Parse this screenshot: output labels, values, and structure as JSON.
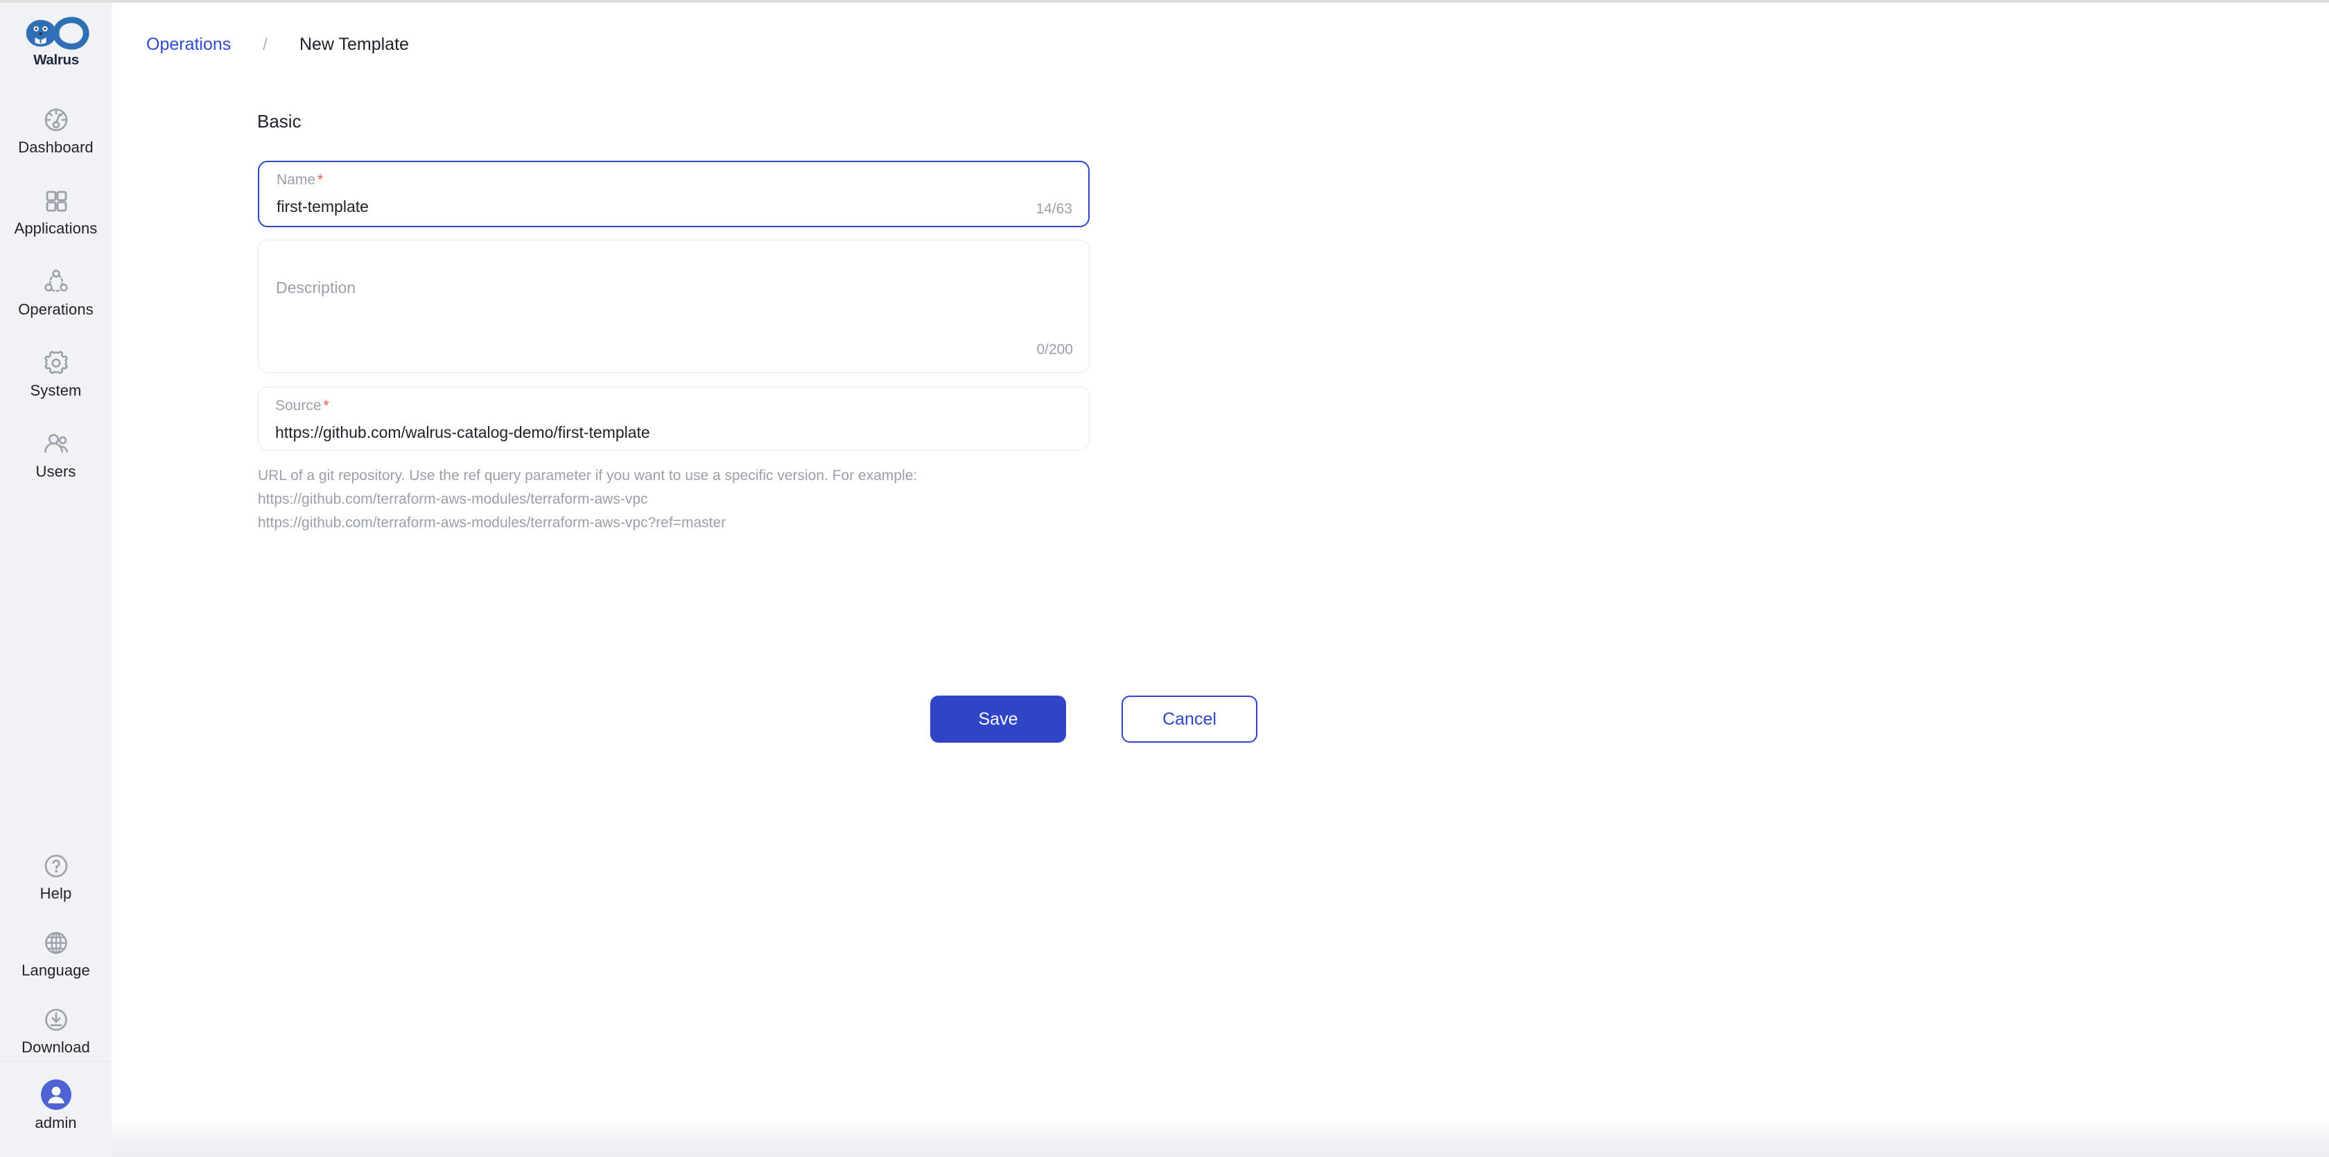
{
  "app": {
    "brand_name": "Walrus",
    "accent_color": "#2f45c5",
    "link_color": "#2f4ad0",
    "sidebar_bg": "#f1f2f4",
    "required_color": "#e8544a"
  },
  "sidebar": {
    "logo_icon": "walrus-infinity-logo",
    "items": [
      {
        "label": "Dashboard",
        "icon": "dashboard-gauge-icon"
      },
      {
        "label": "Applications",
        "icon": "grid-squares-icon"
      },
      {
        "label": "Operations",
        "icon": "nodes-network-icon"
      },
      {
        "label": "System",
        "icon": "gear-icon"
      },
      {
        "label": "Users",
        "icon": "users-icon"
      }
    ],
    "bottom_items": [
      {
        "label": "Help",
        "icon": "question-circle-icon"
      },
      {
        "label": "Language",
        "icon": "globe-icon"
      },
      {
        "label": "Download",
        "icon": "download-circle-icon"
      }
    ],
    "user": {
      "label": "admin",
      "icon": "user-avatar-icon"
    }
  },
  "breadcrumb": {
    "parent": "Operations",
    "separator": "/",
    "current": "New Template"
  },
  "main": {
    "section_title": "Basic",
    "fields": {
      "name": {
        "label": "Name",
        "required_marker": "*",
        "value": "first-template",
        "counter": "14/63",
        "focused": true
      },
      "description": {
        "label": "Description",
        "placeholder": "Description",
        "value": "",
        "counter": "0/200",
        "focused": false
      },
      "source": {
        "label": "Source",
        "required_marker": "*",
        "value": "https://github.com/walrus-catalog-demo/first-template",
        "focused": false
      }
    },
    "source_hint": {
      "line1": "URL of a git repository. Use the ref query parameter if you want to use a specific version. For example:",
      "line2": "https://github.com/terraform-aws-modules/terraform-aws-vpc",
      "line3": "https://github.com/terraform-aws-modules/terraform-aws-vpc?ref=master"
    },
    "actions": {
      "save_label": "Save",
      "cancel_label": "Cancel"
    }
  }
}
